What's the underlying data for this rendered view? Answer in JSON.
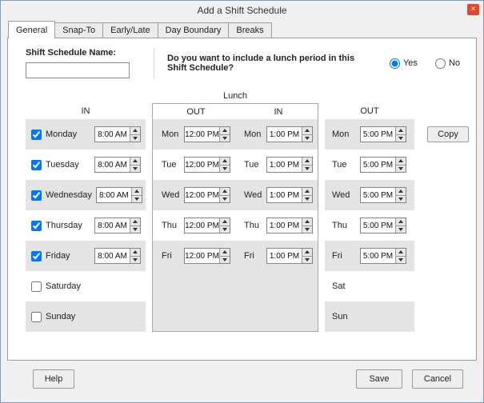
{
  "window": {
    "title": "Add a Shift Schedule",
    "close_glyph": "×"
  },
  "tabs": [
    {
      "label": "General",
      "active": true
    },
    {
      "label": "Snap-To",
      "active": false
    },
    {
      "label": "Early/Late",
      "active": false
    },
    {
      "label": "Day Boundary",
      "active": false
    },
    {
      "label": "Breaks",
      "active": false
    }
  ],
  "form": {
    "name_label": "Shift Schedule Name:",
    "name_value": "",
    "lunch_question": "Do you want to include a lunch period in this Shift Schedule?",
    "options": [
      {
        "label": "Yes",
        "selected": true
      },
      {
        "label": "No",
        "selected": false
      }
    ]
  },
  "schedule": {
    "lunch_header": "Lunch",
    "col_in": "IN",
    "col_out": "OUT",
    "copy_label": "Copy",
    "rows": [
      {
        "day": "Monday",
        "abbr": "Mon",
        "checked": true,
        "in": "8:00 AM",
        "lunch_out": "12:00 PM",
        "lunch_in": "1:00 PM",
        "out": "5:00 PM"
      },
      {
        "day": "Tuesday",
        "abbr": "Tue",
        "checked": true,
        "in": "8:00 AM",
        "lunch_out": "12:00 PM",
        "lunch_in": "1:00 PM",
        "out": "5:00 PM"
      },
      {
        "day": "Wednesday",
        "abbr": "Wed",
        "checked": true,
        "in": "8:00 AM",
        "lunch_out": "12:00 PM",
        "lunch_in": "1:00 PM",
        "out": "5:00 PM"
      },
      {
        "day": "Thursday",
        "abbr": "Thu",
        "checked": true,
        "in": "8:00 AM",
        "lunch_out": "12:00 PM",
        "lunch_in": "1:00 PM",
        "out": "5:00 PM"
      },
      {
        "day": "Friday",
        "abbr": "Fri",
        "checked": true,
        "in": "8:00 AM",
        "lunch_out": "12:00 PM",
        "lunch_in": "1:00 PM",
        "out": "5:00 PM"
      },
      {
        "day": "Saturday",
        "abbr": "Sat",
        "checked": false
      },
      {
        "day": "Sunday",
        "abbr": "Sun",
        "checked": false
      }
    ]
  },
  "footer": {
    "help": "Help",
    "save": "Save",
    "cancel": "Cancel"
  },
  "colors": {
    "stripe": "#e4e4e4",
    "close_button": "#e0492f",
    "dialog_bg": "#f0f0f0"
  }
}
